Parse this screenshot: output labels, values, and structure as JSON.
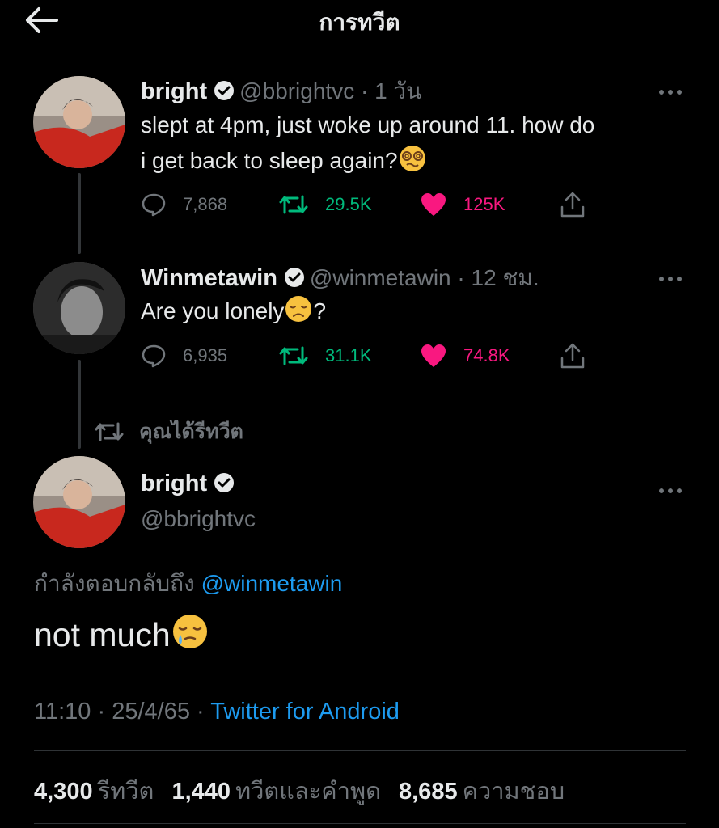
{
  "header": {
    "title": "การทวีต"
  },
  "tweet1": {
    "name": "bright",
    "handle_time": "@bbrightvc · 1 วัน",
    "text_line1": "slept at 4pm, just woke up around 11. how do",
    "text_line2": "i get back to sleep again?",
    "emoji": "dizzy-face",
    "replies": "7,868",
    "retweets": "29.5K",
    "likes": "125K"
  },
  "tweet2": {
    "name": "Winmetawin",
    "handle_time": "@winmetawin · 12 ชม.",
    "text_before": "Are you lonely",
    "text_after": "?",
    "emoji": "disappointed-face",
    "replies": "6,935",
    "retweets": "31.1K",
    "likes": "74.8K"
  },
  "retweeted_label": "คุณได้รีทวีต",
  "main": {
    "name": "bright",
    "handle": "@bbrightvc",
    "replying_prefix": "กำลังตอบกลับถึง",
    "replying_to": "@winmetawin",
    "text": "not much",
    "emoji": "sleepy-face",
    "timestamp": "11:10 · 25/4/65 · ",
    "source": "Twitter for Android",
    "stats": {
      "retweets_num": "4,300",
      "retweets_label": "รีทวีต",
      "quotes_num": "1,440",
      "quotes_label": "ทวีตและคำพูด",
      "likes_num": "8,685",
      "likes_label": "ความชอบ"
    }
  },
  "colors": {
    "background": "#000000",
    "text": "#e7e9ea",
    "secondary": "#71767b",
    "link": "#1d9bf0",
    "retweet": "#00ba7c",
    "like": "#f91880"
  }
}
